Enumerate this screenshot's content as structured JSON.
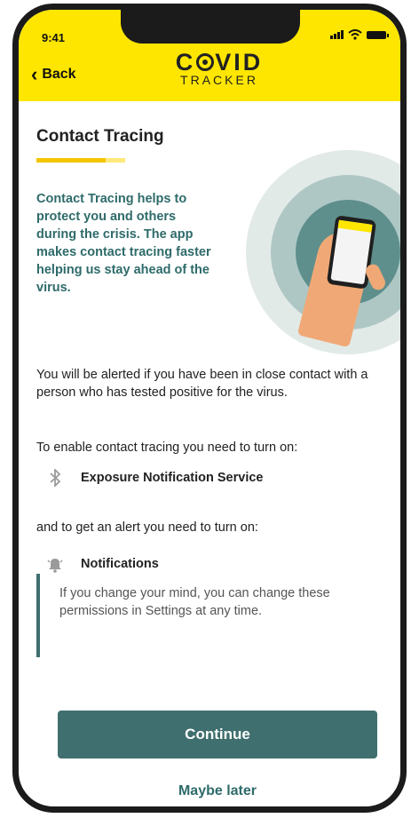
{
  "status": {
    "time": "9:41"
  },
  "header": {
    "back_label": "Back",
    "logo_line1_left": "C",
    "logo_line1_right": "VID",
    "logo_line2": "TRACKER"
  },
  "page": {
    "title": "Contact Tracing",
    "intro": "Contact Tracing helps to protect you and others during the crisis. The app makes contact tracing faster helping us stay ahead of the virus.",
    "alert_text": "You will be alerted if you have been in close contact with a person who has tested positive for the virus.",
    "enable_text": "To enable contact tracing you need to turn on:",
    "permission_1": "Exposure Notification Service",
    "alert_need_text": "and to get an alert you need to turn on:",
    "permission_2": "Notifications",
    "note": "If you change your mind, you can change these permissions in Settings at any time."
  },
  "actions": {
    "continue_label": "Continue",
    "maybe_later_label": "Maybe later"
  },
  "colors": {
    "brand_yellow": "#ffe600",
    "accent_teal": "#3f6f6e",
    "teal_text": "#2e6b6a"
  },
  "icons": [
    "bluetooth-icon",
    "bell-icon",
    "chevron-left-icon",
    "signal-icon",
    "wifi-icon",
    "battery-icon"
  ]
}
